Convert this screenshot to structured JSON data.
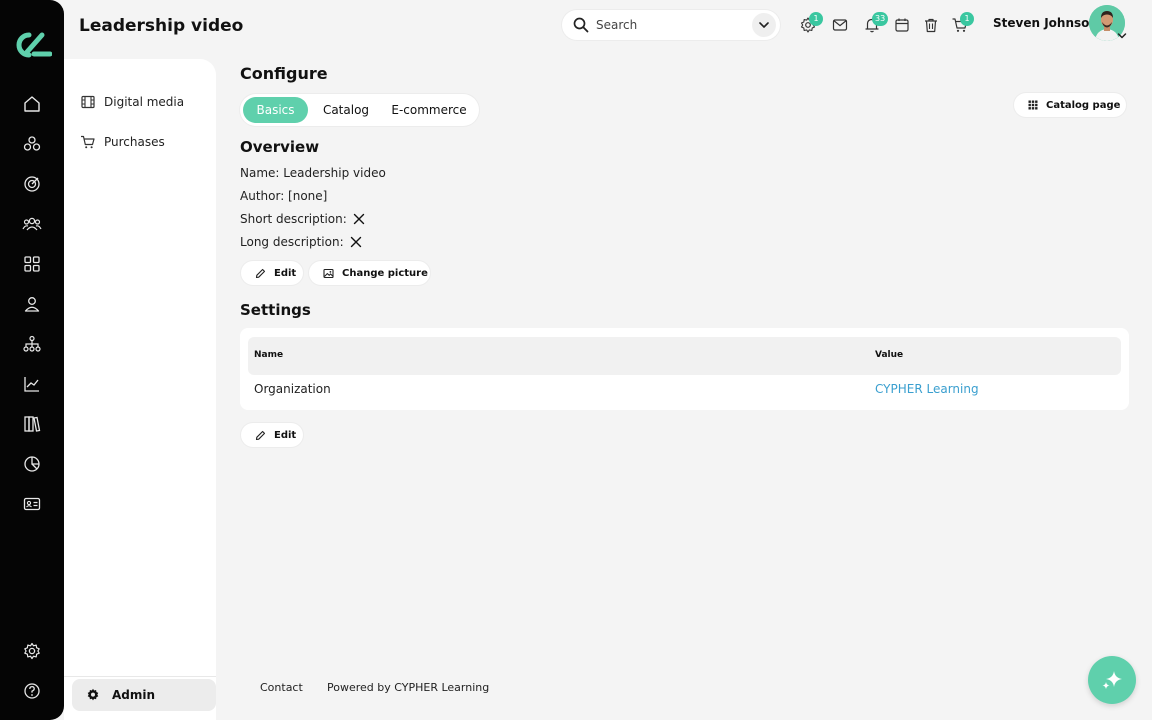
{
  "header": {
    "page_title": "Leadership video",
    "search_placeholder": "Search",
    "badges": {
      "settings": "1",
      "notifications": "33",
      "cart": "1"
    },
    "user_name": "Steven Johnson"
  },
  "rail": {
    "icons": [
      "home-icon",
      "courses-icon",
      "goals-icon",
      "users-icon",
      "apps-icon",
      "profile-icon",
      "org-chart-icon",
      "analytics-icon",
      "library-icon",
      "reports-icon",
      "id-card-icon",
      "settings-icon",
      "help-icon"
    ]
  },
  "subnav": {
    "items": [
      {
        "label": "Digital media",
        "icon": "film-icon"
      },
      {
        "label": "Purchases",
        "icon": "cart-icon"
      }
    ],
    "admin_label": "Admin"
  },
  "main": {
    "heading": "Configure",
    "tabs": [
      {
        "label": "Basics",
        "active": true
      },
      {
        "label": "Catalog",
        "active": false
      },
      {
        "label": "E-commerce",
        "active": false
      }
    ],
    "catalog_page_label": "Catalog page",
    "overview": {
      "heading": "Overview",
      "name_line": "Name: Leadership video",
      "author_line": "Author: [none]",
      "short_desc_label": "Short description:",
      "long_desc_label": "Long description:",
      "edit_label": "Edit",
      "change_picture_label": "Change picture"
    },
    "settings": {
      "heading": "Settings",
      "columns": [
        "Name",
        "Value"
      ],
      "rows": [
        {
          "name": "Organization",
          "value": "CYPHER Learning"
        }
      ],
      "edit_label": "Edit"
    }
  },
  "footer": {
    "contact": "Contact",
    "powered_by": "Powered by CYPHER Learning"
  },
  "colors": {
    "accent": "#5fd0ac",
    "link": "#3a9fcf",
    "rail": "#050505"
  }
}
